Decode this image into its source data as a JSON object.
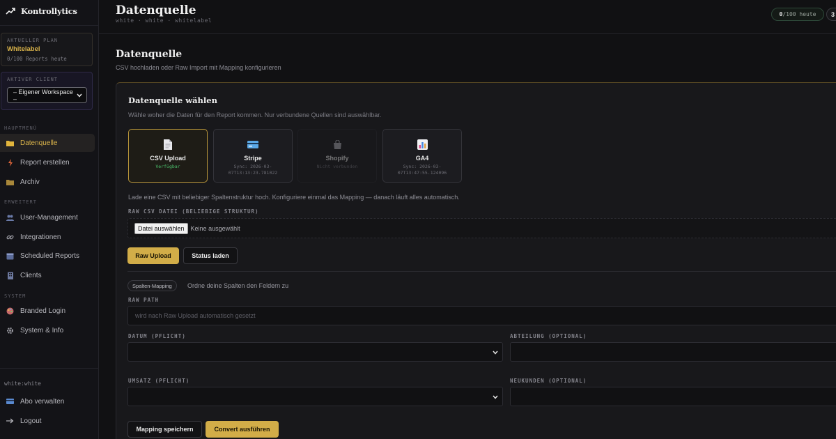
{
  "app": {
    "name": "Kontrollytics"
  },
  "sidebar": {
    "plan": {
      "caption": "AKTUELLER PLAN",
      "name": "Whitelabel",
      "usage": "0/100 Reports heute"
    },
    "client": {
      "caption": "AKTIVER CLIENT",
      "selected": "– Eigener Workspace –"
    },
    "sections": [
      {
        "title": "HAUPTMENÜ",
        "items": [
          {
            "label": "Datenquelle",
            "icon": "folder-icon",
            "active": true
          },
          {
            "label": "Report erstellen",
            "icon": "bolt-icon"
          },
          {
            "label": "Archiv",
            "icon": "archive-folder-icon"
          }
        ]
      },
      {
        "title": "ERWEITERT",
        "items": [
          {
            "label": "User-Management",
            "icon": "users-icon"
          },
          {
            "label": "Integrationen",
            "icon": "link-icon"
          },
          {
            "label": "Scheduled Reports",
            "icon": "calendar-icon"
          },
          {
            "label": "Clients",
            "icon": "building-icon"
          }
        ]
      },
      {
        "title": "SYSTEM",
        "items": [
          {
            "label": "Branded Login",
            "icon": "palette-icon"
          },
          {
            "label": "System & Info",
            "icon": "gear-icon"
          }
        ]
      }
    ],
    "user": "white:white",
    "footer": [
      {
        "label": "Abo verwalten",
        "icon": "credit-card-icon"
      },
      {
        "label": "Logout",
        "icon": "arrow-right-icon"
      }
    ]
  },
  "header": {
    "title": "Datenquelle",
    "breadcrumb": "white · white · whitelabel",
    "usage_value": "0",
    "usage_rest": "/100 heute",
    "pill2": "3"
  },
  "main": {
    "title": "Datenquelle",
    "subtitle": "CSV hochladen oder Raw Import mit Mapping konfigurieren",
    "card": {
      "title": "Datenquelle wählen",
      "subtitle": "Wähle woher die Daten für den Report kommen. Nur verbundene Quellen sind auswählbar.",
      "sources": [
        {
          "name": "CSV Upload",
          "status": "Verfügbar",
          "icon": "document-icon"
        },
        {
          "name": "Stripe",
          "status": "Sync: 2026-03-07T13:13:23.781022",
          "icon": "credit-card-icon"
        },
        {
          "name": "Shopify",
          "status": "Nicht verbunden",
          "icon": "shopping-bag-icon"
        },
        {
          "name": "GA4",
          "status": "Sync: 2026-03-07T13:47:55.124096",
          "icon": "bar-chart-icon"
        }
      ],
      "info": "Lade eine CSV mit beliebiger Spaltenstruktur hoch. Konfiguriere einmal das Mapping — danach läuft alles automatisch.",
      "file_label": "RAW CSV DATEI (BELIEBIGE STRUKTUR)",
      "file_button": "Datei auswählen",
      "file_none": "Keine ausgewählt",
      "raw_upload": "Raw Upload",
      "status_laden": "Status laden",
      "mapping_tag": "Spalten-Mapping",
      "mapping_desc": "Ordne deine Spalten den Feldern zu",
      "raw_path_label": "RAW PATH",
      "raw_path_placeholder": "wird nach Raw Upload automatisch gesetzt",
      "datum_label": "DATUM (PFLICHT)",
      "abteilung_label": "ABTEILUNG (OPTIONAL)",
      "umsatz_label": "UMSATZ (PFLICHT)",
      "neukunden_label": "NEUKUNDEN (OPTIONAL)",
      "save_mapping": "Mapping speichern",
      "convert": "Convert ausführen"
    }
  },
  "colors": {
    "accent": "#d2ad48",
    "ok": "#4bbf6b",
    "bg": "#111113"
  }
}
